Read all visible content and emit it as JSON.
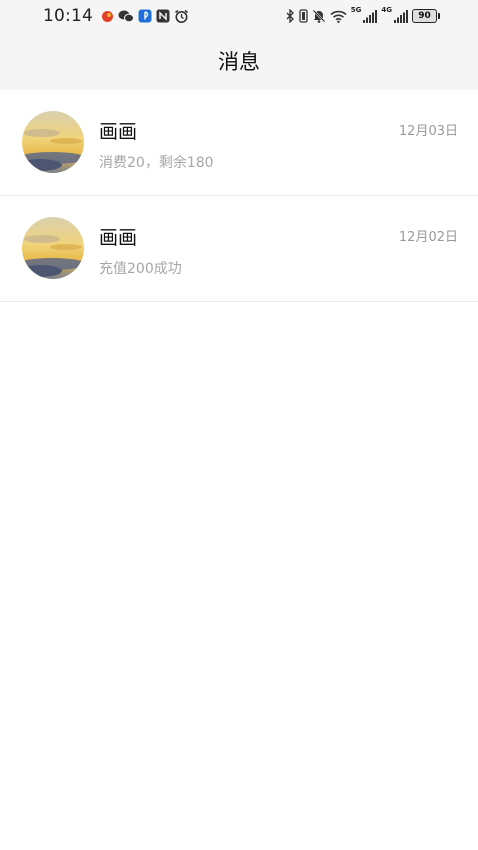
{
  "status_bar": {
    "time": "10:14",
    "left_icons": [
      "weibo-notification-icon",
      "wechat-icon",
      "bluetooth-app-icon",
      "nfc-icon",
      "alarm-icon"
    ],
    "right_icons": [
      "bluetooth-icon",
      "vibrate-icon",
      "mute-icon",
      "wifi-icon",
      "signal-5g-icon",
      "signal-4g-icon"
    ],
    "net1": "5G",
    "net2": "4G",
    "battery": "90"
  },
  "header": {
    "title": "消息"
  },
  "messages": [
    {
      "sender": "画画",
      "preview": "消费20，剩余180",
      "date": "12月03日"
    },
    {
      "sender": "画画",
      "preview": "充值200成功",
      "date": "12月02日"
    }
  ]
}
